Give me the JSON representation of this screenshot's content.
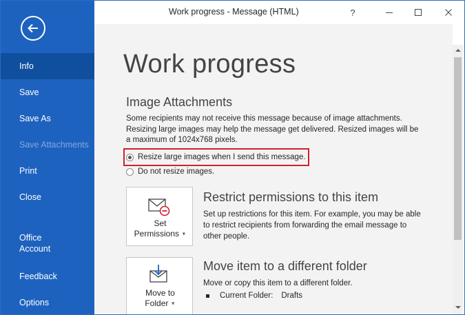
{
  "window": {
    "title": "Work progress  -  Message (HTML)",
    "help_label": "?"
  },
  "sidebar": {
    "items": [
      {
        "label": "Info",
        "state": "active"
      },
      {
        "label": "Save",
        "state": "normal"
      },
      {
        "label": "Save As",
        "state": "normal"
      },
      {
        "label": "Save Attachments",
        "state": "disabled"
      },
      {
        "label": "Print",
        "state": "normal"
      },
      {
        "label": "Close",
        "state": "normal"
      },
      {
        "label_line1": "Office",
        "label_line2": "Account",
        "state": "normal"
      },
      {
        "label": "Feedback",
        "state": "normal"
      },
      {
        "label": "Options",
        "state": "normal"
      }
    ],
    "colors": {
      "background": "#1e62bf",
      "active": "#0f4f9e"
    }
  },
  "main": {
    "page_title": "Work progress",
    "image_attachments": {
      "title": "Image Attachments",
      "description": "Some recipients may not receive this message because of image attachments. Resizing large images may help the message get delivered. Resized images will be a maximum of 1024x768 pixels.",
      "options": [
        {
          "label": "Resize large images when I send this message.",
          "checked": true
        },
        {
          "label": "Do not resize images.",
          "checked": false
        }
      ]
    },
    "permissions": {
      "button_line1": "Set",
      "button_line2": "Permissions",
      "title": "Restrict permissions to this item",
      "description": "Set up restrictions for this item. For example, you may be able to restrict recipients from forwarding the email message to other people."
    },
    "move": {
      "button_line1": "Move to",
      "button_line2": "Folder",
      "title": "Move item to a different folder",
      "description": "Move or copy this item to a different folder.",
      "current_folder_label": "Current Folder:",
      "current_folder_value": "Drafts"
    }
  },
  "icons": [
    "back-arrow-icon",
    "minimize-icon",
    "maximize-icon",
    "close-icon",
    "envelope-restrict-icon",
    "move-to-folder-icon",
    "caret-down-icon",
    "scroll-up-icon",
    "scroll-down-icon"
  ],
  "accent_colors": {
    "highlight_border": "#d21f2f",
    "restrict_icon": "#d21f2f",
    "folder_icon": "#1e62bf"
  }
}
